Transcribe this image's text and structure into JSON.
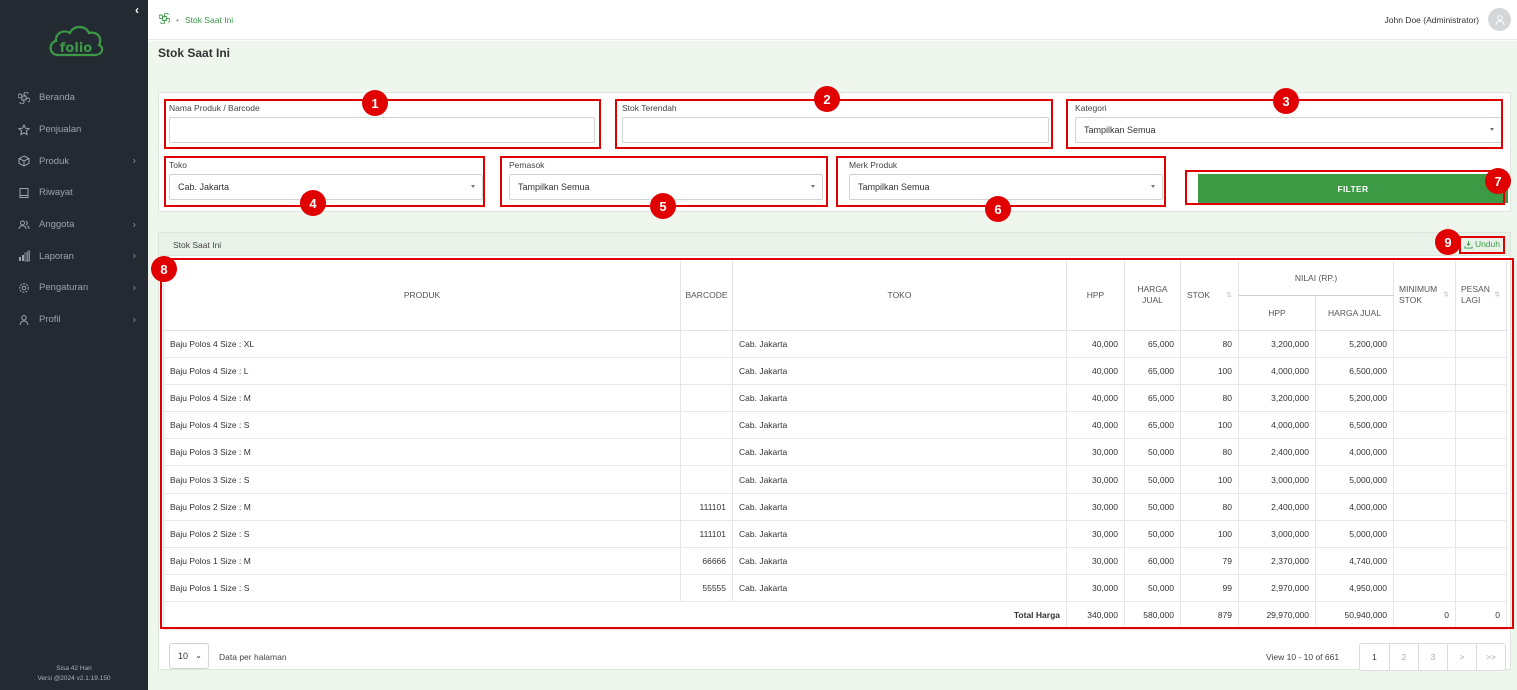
{
  "app": {
    "logo_text": "folio",
    "collapse_glyph": "‹"
  },
  "sidebar": {
    "items": [
      {
        "label": "Beranda",
        "icon": "command-icon",
        "has_children": false
      },
      {
        "label": "Penjualan",
        "icon": "star-icon",
        "has_children": false
      },
      {
        "label": "Produk",
        "icon": "box-icon",
        "has_children": true
      },
      {
        "label": "Riwayat",
        "icon": "book-icon",
        "has_children": false
      },
      {
        "label": "Anggota",
        "icon": "users-icon",
        "has_children": true
      },
      {
        "label": "Laporan",
        "icon": "bar-chart-icon",
        "has_children": true
      },
      {
        "label": "Pengaturan",
        "icon": "gear-icon",
        "has_children": true
      },
      {
        "label": "Profil",
        "icon": "user-icon",
        "has_children": true
      }
    ],
    "footer": {
      "line1": "Sisa 42 Hari",
      "line2": "Versi @2024 v2.1.19.150"
    }
  },
  "header": {
    "breadcrumb": "Stok Saat Ini",
    "user": "John Doe (Administrator)"
  },
  "page": {
    "title": "Stok Saat Ini"
  },
  "filters": {
    "product": {
      "label": "Nama Produk / Barcode",
      "value": "",
      "placeholder": ""
    },
    "lowest_stock": {
      "label": "Stok Terendah",
      "value": "",
      "placeholder": ""
    },
    "category": {
      "label": "Kategori",
      "value": "Tampilkan Semua"
    },
    "store": {
      "label": "Toko",
      "value": "Cab. Jakarta"
    },
    "supplier": {
      "label": "Pemasok",
      "value": "Tampilkan Semua"
    },
    "brand": {
      "label": "Merk Produk",
      "value": "Tampilkan Semua"
    },
    "button": "FILTER"
  },
  "table": {
    "title": "Stok Saat Ini",
    "download": "Unduh",
    "headers": {
      "produk": "PRODUK",
      "barcode": "BARCODE",
      "toko": "TOKO",
      "hpp": "HPP",
      "harga_jual": "HARGA JUAL",
      "stok": "STOK",
      "nilai": "NILAI (RP.)",
      "nilai_hpp": "HPP",
      "nilai_harga_jual": "HARGA JUAL",
      "minimum_stok": "MINIMUM STOK",
      "pesan_lagi": "PESAN LAGI"
    },
    "rows": [
      {
        "produk": "Baju Polos 4 Size : XL",
        "barcode": "",
        "toko": "Cab. Jakarta",
        "hpp": "40,000",
        "harga_jual": "65,000",
        "stok": "80",
        "nilai_hpp": "3,200,000",
        "nilai_jual": "5,200,000",
        "min": "",
        "pesan": ""
      },
      {
        "produk": "Baju Polos 4 Size : L",
        "barcode": "",
        "toko": "Cab. Jakarta",
        "hpp": "40,000",
        "harga_jual": "65,000",
        "stok": "100",
        "nilai_hpp": "4,000,000",
        "nilai_jual": "6,500,000",
        "min": "",
        "pesan": ""
      },
      {
        "produk": "Baju Polos 4 Size : M",
        "barcode": "",
        "toko": "Cab. Jakarta",
        "hpp": "40,000",
        "harga_jual": "65,000",
        "stok": "80",
        "nilai_hpp": "3,200,000",
        "nilai_jual": "5,200,000",
        "min": "",
        "pesan": ""
      },
      {
        "produk": "Baju Polos 4 Size : S",
        "barcode": "",
        "toko": "Cab. Jakarta",
        "hpp": "40,000",
        "harga_jual": "65,000",
        "stok": "100",
        "nilai_hpp": "4,000,000",
        "nilai_jual": "6,500,000",
        "min": "",
        "pesan": ""
      },
      {
        "produk": "Baju Polos 3 Size : M",
        "barcode": "",
        "toko": "Cab. Jakarta",
        "hpp": "30,000",
        "harga_jual": "50,000",
        "stok": "80",
        "nilai_hpp": "2,400,000",
        "nilai_jual": "4,000,000",
        "min": "",
        "pesan": ""
      },
      {
        "produk": "Baju Polos 3 Size : S",
        "barcode": "",
        "toko": "Cab. Jakarta",
        "hpp": "30,000",
        "harga_jual": "50,000",
        "stok": "100",
        "nilai_hpp": "3,000,000",
        "nilai_jual": "5,000,000",
        "min": "",
        "pesan": ""
      },
      {
        "produk": "Baju Polos 2 Size : M",
        "barcode": "111101",
        "toko": "Cab. Jakarta",
        "hpp": "30,000",
        "harga_jual": "50,000",
        "stok": "80",
        "nilai_hpp": "2,400,000",
        "nilai_jual": "4,000,000",
        "min": "",
        "pesan": ""
      },
      {
        "produk": "Baju Polos 2 Size : S",
        "barcode": "111101",
        "toko": "Cab. Jakarta",
        "hpp": "30,000",
        "harga_jual": "50,000",
        "stok": "100",
        "nilai_hpp": "3,000,000",
        "nilai_jual": "5,000,000",
        "min": "",
        "pesan": ""
      },
      {
        "produk": "Baju Polos 1 Size : M",
        "barcode": "66666",
        "toko": "Cab. Jakarta",
        "hpp": "30,000",
        "harga_jual": "60,000",
        "stok": "79",
        "nilai_hpp": "2,370,000",
        "nilai_jual": "4,740,000",
        "min": "",
        "pesan": ""
      },
      {
        "produk": "Baju Polos 1 Size : S",
        "barcode": "55555",
        "toko": "Cab. Jakarta",
        "hpp": "30,000",
        "harga_jual": "50,000",
        "stok": "99",
        "nilai_hpp": "2,970,000",
        "nilai_jual": "4,950,000",
        "min": "",
        "pesan": ""
      }
    ],
    "total": {
      "label": "Total Harga",
      "hpp": "340,000",
      "harga_jual": "580,000",
      "stok": "879",
      "nilai_hpp": "29,970,000",
      "nilai_jual": "50,940,000",
      "min": "0",
      "pesan": "0"
    }
  },
  "pagination": {
    "per_page": "10",
    "per_page_label": "Data per halaman",
    "view_info": "View 10 - 10 of 661",
    "pages": [
      "1",
      "2",
      "3",
      ">",
      ">>"
    ]
  },
  "annotations": [
    "1",
    "2",
    "3",
    "4",
    "5",
    "6",
    "7",
    "8",
    "9"
  ],
  "colors": {
    "sidebar": "#232a32",
    "accent": "#3c9a45",
    "annotation": "#e00000"
  }
}
